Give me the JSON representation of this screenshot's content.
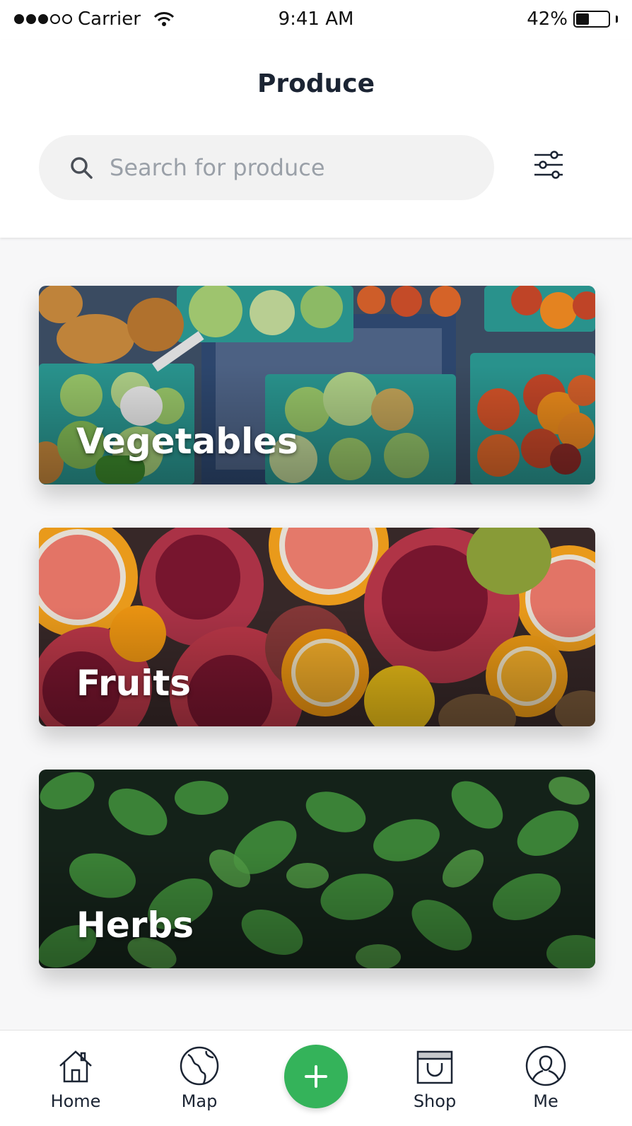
{
  "status_bar": {
    "carrier": "Carrier",
    "time": "9:41 AM",
    "battery": "42%",
    "battery_level": 0.42
  },
  "header": {
    "title": "Produce"
  },
  "search": {
    "placeholder": "Search for produce",
    "value": ""
  },
  "categories": [
    {
      "label": "Vegetables",
      "image": "vegetables-photo"
    },
    {
      "label": "Fruits",
      "image": "fruits-photo"
    },
    {
      "label": "Herbs",
      "image": "herbs-photo"
    }
  ],
  "tab_bar": {
    "items": [
      {
        "label": "Home",
        "icon": "home-icon"
      },
      {
        "label": "Map",
        "icon": "globe-icon"
      },
      {
        "label": "Shop",
        "icon": "shop-bag-icon"
      },
      {
        "label": "Me",
        "icon": "user-icon"
      }
    ],
    "add_icon": "plus-icon"
  },
  "colors": {
    "accent": "#34b35a",
    "text": "#1b2433",
    "placeholder": "#9aa0a8",
    "search_bg": "#f2f2f2"
  }
}
